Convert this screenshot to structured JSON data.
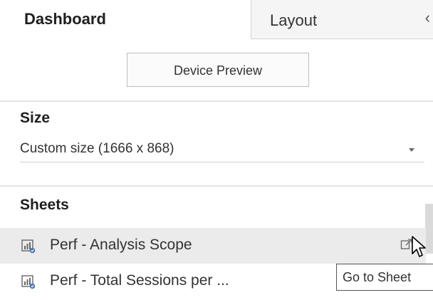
{
  "tabs": {
    "dashboard_label": "Dashboard",
    "layout_label": "Layout",
    "collapse_glyph": "‹"
  },
  "device_preview": {
    "label": "Device Preview"
  },
  "size": {
    "title": "Size",
    "selected": "Custom size (1666 x 868)"
  },
  "sheets": {
    "title": "Sheets",
    "items": [
      {
        "label": "Perf - Analysis Scope"
      },
      {
        "label": "Perf - Total Sessions per ..."
      }
    ]
  },
  "tooltip": {
    "text": "Go to Sheet"
  },
  "icons": {
    "sheet": "worksheet-icon",
    "goto": "go-to-sheet-icon",
    "dropdown": "chevron-down-icon",
    "cursor": "mouse-pointer-icon"
  },
  "colors": {
    "accent_badge": "#4a78b5",
    "hover_row": "#ebebeb"
  }
}
